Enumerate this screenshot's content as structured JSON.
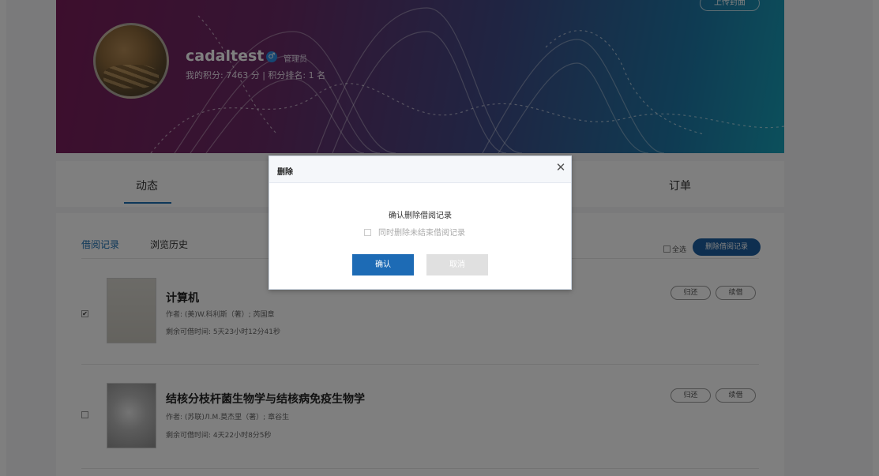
{
  "profile": {
    "username": "cadaltest",
    "gender_symbol": "♂",
    "role": "管理员",
    "points_text": "我的积分: 7463 分 | 积分排名: 1 名",
    "cover_button": "上传封面"
  },
  "tabs": {
    "items": [
      {
        "label": "动态",
        "active": true
      },
      {
        "label": "订单",
        "active": false
      }
    ]
  },
  "borrow": {
    "subtabs": [
      {
        "label": "借阅记录",
        "active": true
      },
      {
        "label": "浏览历史",
        "active": false
      }
    ],
    "select_all_label": "全选",
    "delete_button": "删除借阅记录",
    "books": [
      {
        "checked": true,
        "title": "计算机",
        "author": "作者: (美)W.科利斯（著）; 芮国章",
        "remaining": "剩余可借时间: 5天23小时12分41秒",
        "return_label": "归还",
        "renew_label": "续借"
      },
      {
        "checked": false,
        "title": "结核分枝杆菌生物学与结核病免疫生物学",
        "author": "作者: (苏联)Л.M.莫杰里（著）; 章谷生",
        "remaining": "剩余可借时间: 4天22小时8分5秒",
        "return_label": "归还",
        "renew_label": "续借"
      }
    ]
  },
  "dialog": {
    "title": "删除",
    "close_symbol": "✕",
    "message": "确认删除借阅记录",
    "option_label": "同时删除未结束借阅记录",
    "confirm_label": "确认",
    "cancel_label": "取消"
  },
  "colors": {
    "accent": "#1d6bb5",
    "overlay": "rgba(0,0,0,0.5)"
  }
}
